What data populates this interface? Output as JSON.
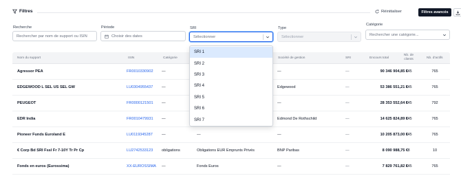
{
  "header": {
    "title": "Filtres",
    "reset_label": "Réinitialiser",
    "advanced_label": "Filtres avancés"
  },
  "filters": {
    "search": {
      "label": "Recherche",
      "placeholder": "Rechercher par nom de support ou ISIN"
    },
    "period": {
      "label": "Période",
      "placeholder": "Choisir des dates"
    },
    "sri": {
      "label": "SRI",
      "placeholder": "Sélectionner",
      "options": [
        "SRI 1",
        "SRI 2",
        "SRI 3",
        "SRI 4",
        "SRI 5",
        "SRI 6",
        "SRI 7"
      ]
    },
    "type": {
      "label": "Type",
      "placeholder": "Sélectionner"
    },
    "category": {
      "label": "Catégorie",
      "placeholder": "Rechercher une catégorie..."
    }
  },
  "table": {
    "headers": {
      "name": "Nom du support",
      "isin": "ISIN",
      "category": "Catégorie",
      "sri_cat": "SRI",
      "company": "Société de gestion",
      "sri": "SRI",
      "outstanding": "Encours total",
      "clients_1": "Nb. de",
      "clients_2": "clients",
      "assets": "Nb. d'actifs"
    },
    "rows": [
      {
        "name": "Agressor PEA",
        "isin": "FR0010330902",
        "category": "—",
        "sri_cat": "—",
        "company": "—",
        "sri": "—",
        "outstanding": "90 346 904,85 €",
        "clients": "145",
        "assets": "765"
      },
      {
        "name": "EDGEWOOD L SEL US SEL GW",
        "isin": "LU0304955437",
        "category": "—",
        "sri_cat": "—",
        "company": "Edgewood",
        "sri": "—",
        "outstanding": "53 386 551,21 €",
        "clients": "145",
        "assets": "765"
      },
      {
        "name": "PEUGEOT",
        "isin": "FR0000121501",
        "category": "—",
        "sri_cat": "—",
        "company": "—",
        "sri": "—",
        "outstanding": "28 353 552,64 €",
        "clients": "145",
        "assets": "792"
      },
      {
        "name": "EDR India",
        "isin": "FR0010479931",
        "category": "—",
        "sri_cat": "—",
        "company": "Edmond De Rothschild",
        "sri": "—",
        "outstanding": "14 625 824,89 €",
        "clients": "145",
        "assets": "765"
      },
      {
        "name": "Pioneer Funds Euroland E",
        "isin": "LU0119345287",
        "category": "—",
        "sri_cat": "—",
        "company": "—",
        "sri": "—",
        "outstanding": "10 205 873,00 €",
        "clients": "145",
        "assets": "765"
      },
      {
        "name": "€ Corp Bd SRI Fssl Fr 7-10Y Tr Pr Cp",
        "isin": "LU2742533123",
        "category": "obligations",
        "sri_cat": "Obligations EUR Emprunts Privés",
        "company": "BNP Paribas",
        "sri": "—",
        "outstanding": "8 090 988,75 €",
        "clients": "8",
        "assets": "10"
      },
      {
        "name": "Fonds en euros (Eurossima)",
        "isin": "XX-EUROSSIMA",
        "category": "—",
        "sri_cat": "Fonds Euros",
        "company": "—",
        "sri": "—",
        "outstanding": "7 829 761,82 €",
        "clients": "145",
        "assets": "765"
      }
    ]
  },
  "colors": {
    "accent": "#2563eb",
    "dark_button": "#111827",
    "highlight": "#dbeafe"
  }
}
